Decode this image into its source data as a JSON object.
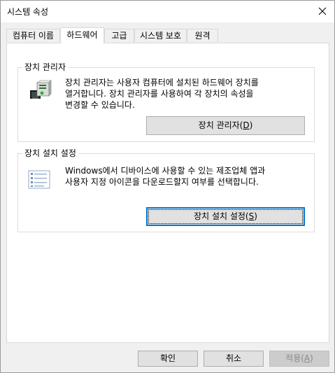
{
  "window": {
    "title": "시스템 속성"
  },
  "tabs": [
    {
      "label": "컴퓨터 이름"
    },
    {
      "label": "하드웨어",
      "active": true
    },
    {
      "label": "고급"
    },
    {
      "label": "시스템 보호"
    },
    {
      "label": "원격"
    }
  ],
  "device_manager": {
    "group_title": "장치 관리자",
    "description_line1": "장치 관리자는 사용자 컴퓨터에 설치된 하드웨어 장치를",
    "description_line2": "열거합니다. 장치 관리자를 사용하여 각 장치의 속성을",
    "description_line3": "변경할 수 있습니다.",
    "button_text": "장치 관리자(",
    "button_accel": "D",
    "button_close": ")"
  },
  "device_install": {
    "group_title": "장치 설치 설정",
    "description_line1": "Windows에서 디바이스에 사용할 수 있는 제조업체 앱과",
    "description_line2": "사용자 지정 아이콘을 다운로드할지 여부를 선택합니다.",
    "button_text": "장치 설치 설정(",
    "button_accel": "S",
    "button_close": ")"
  },
  "footer": {
    "ok_label": "확인",
    "cancel_label": "취소",
    "apply_text": "적용(",
    "apply_accel": "A",
    "apply_close": ")"
  },
  "icons": {
    "device_manager": "device-manager-icon",
    "device_install": "checklist-icon",
    "close": "close-icon"
  }
}
